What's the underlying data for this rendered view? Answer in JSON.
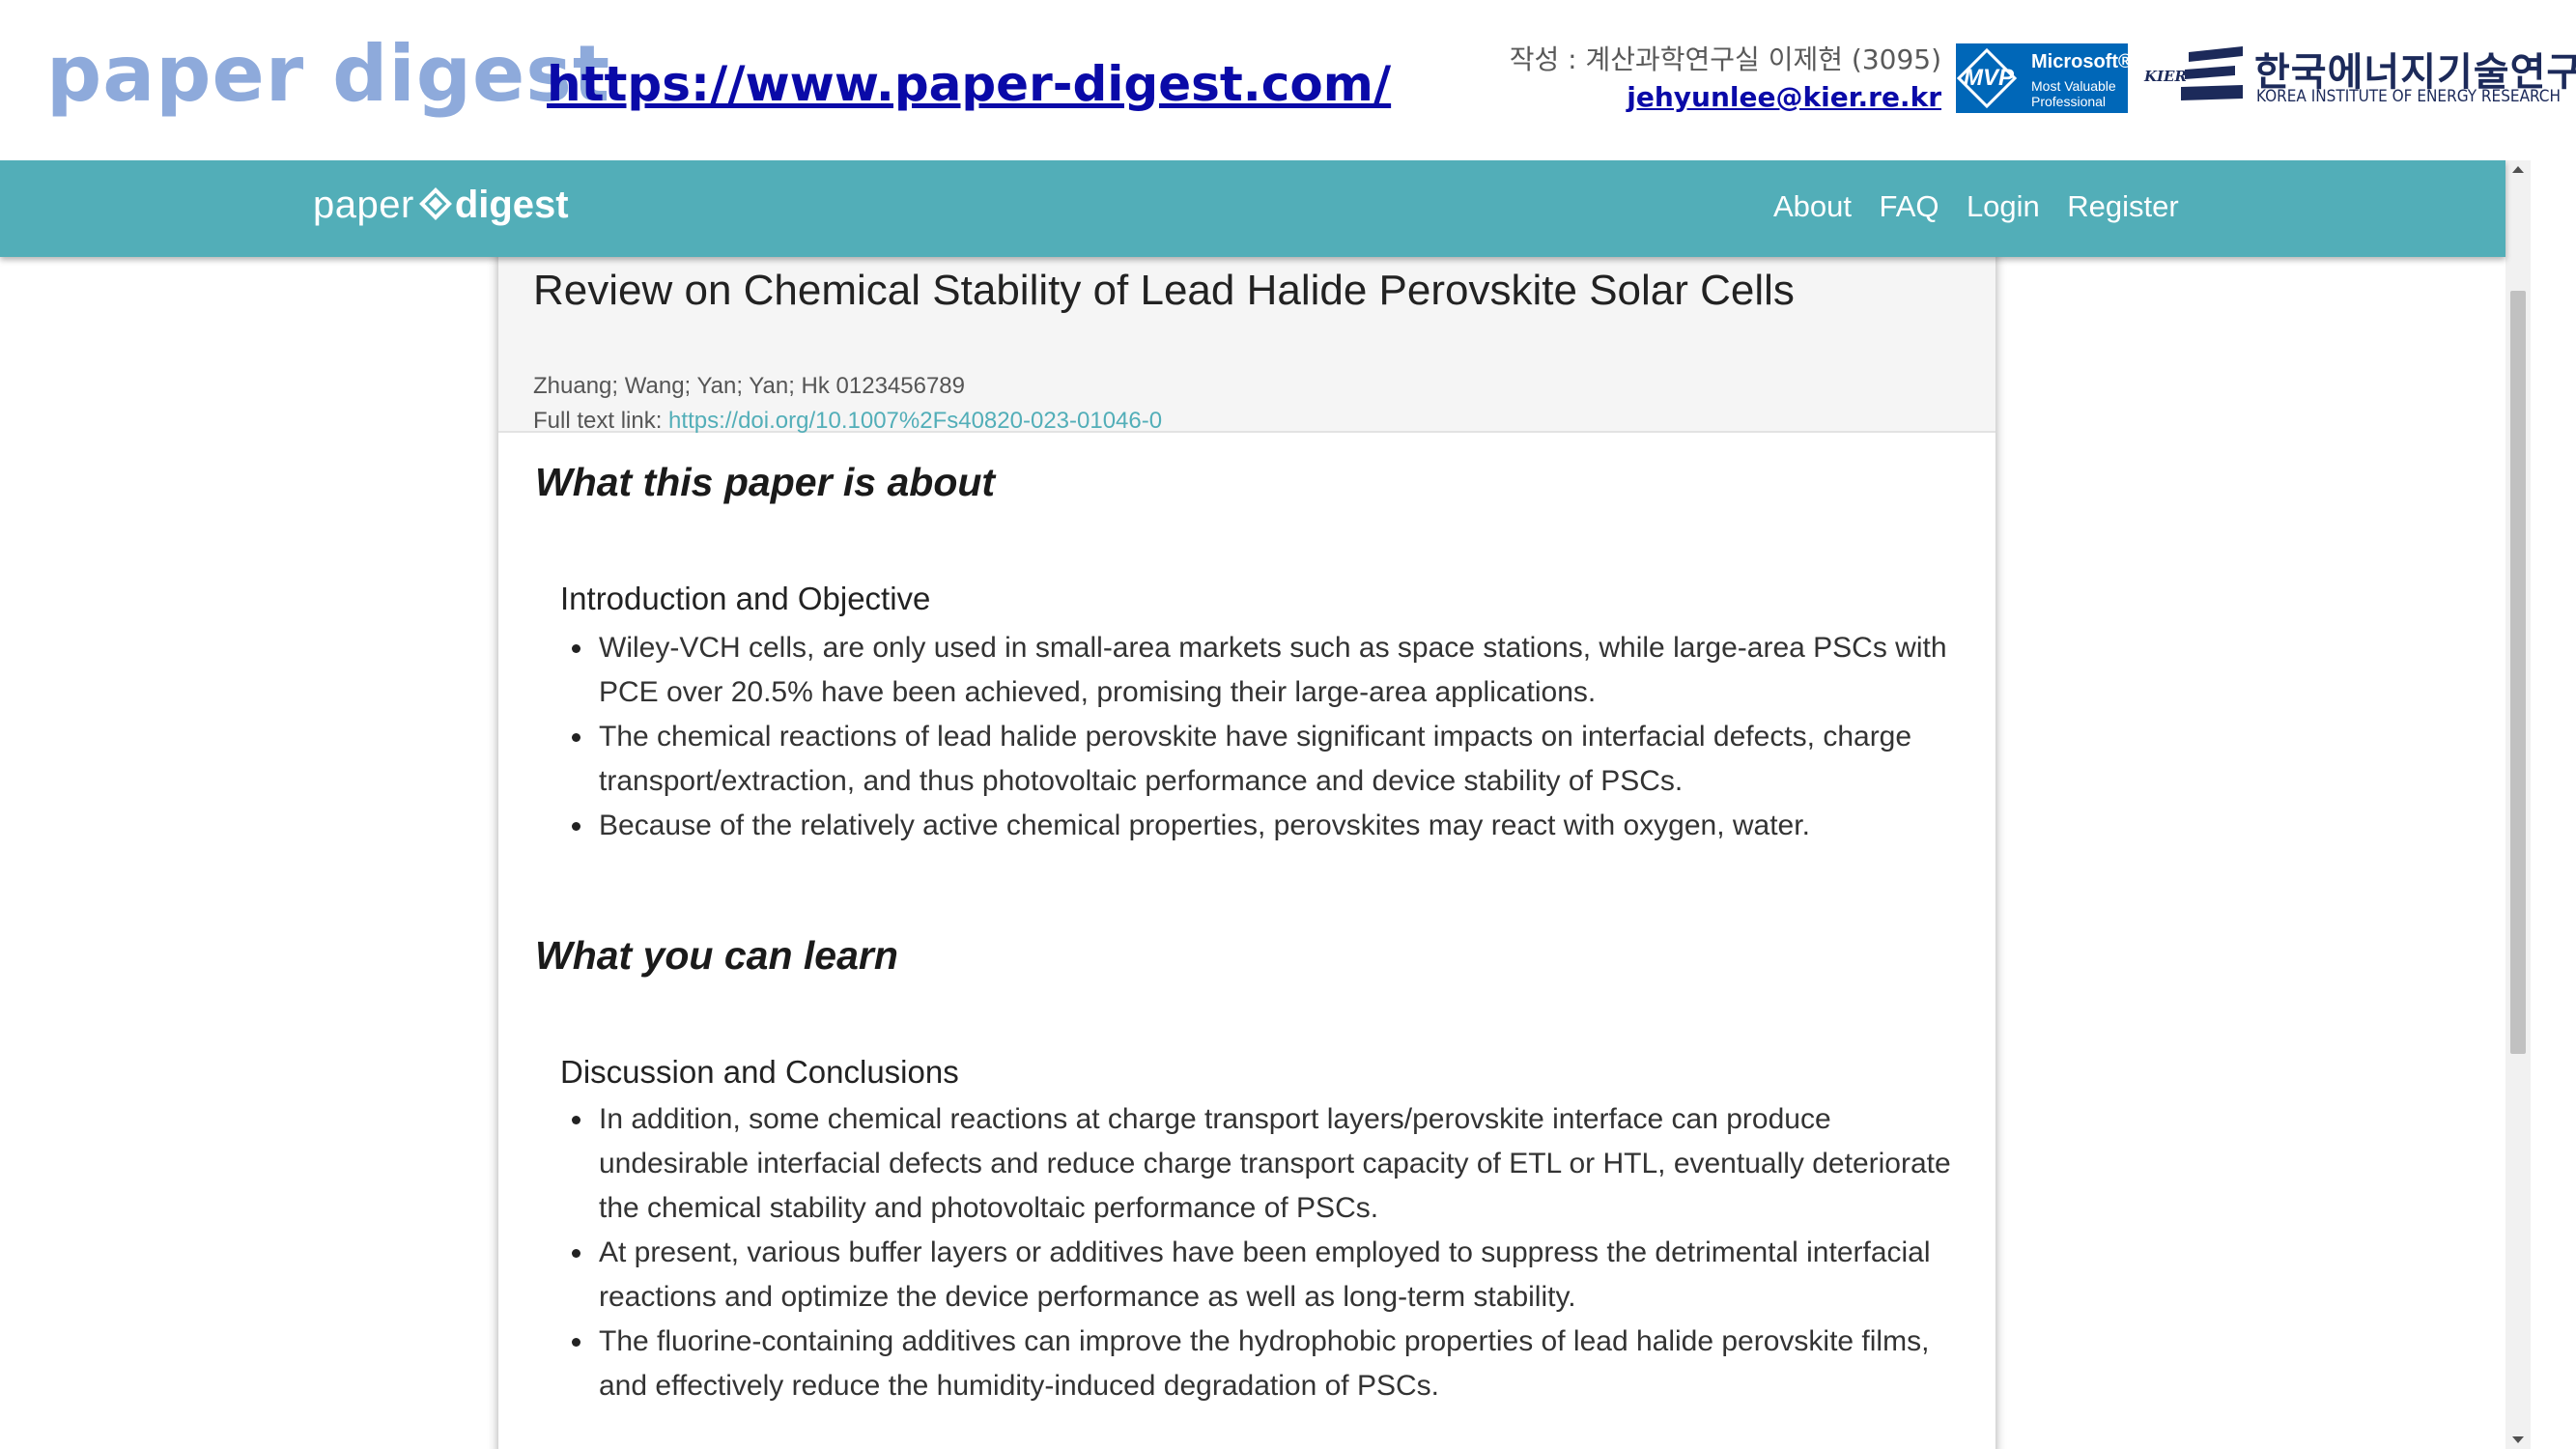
{
  "slide": {
    "title": "paper digest",
    "url": "https://www.paper-digest.com/",
    "author_line": "작성 : 계산과학연구실 이제현 (3095)",
    "author_email": "jehyunlee@kier.re.kr",
    "mvp": {
      "abbr": "MVP",
      "brand": "Microsoft®",
      "line1": "Most Valuable",
      "line2": "Professional"
    },
    "kier": {
      "mark": "KIER",
      "korean": "한국에너지기술연구원",
      "english": "KOREA INSTITUTE OF ENERGY RESEARCH"
    }
  },
  "navbar": {
    "brand_paper": "paper",
    "brand_digest": "digest",
    "links": [
      "About",
      "FAQ",
      "Login",
      "Register"
    ]
  },
  "paper": {
    "title": "Review on Chemical Stability of Lead Halide Perovskite Solar Cells",
    "authors": "Zhuang; Wang; Yan; Yan; Hk 0123456789",
    "link_label": "Full text link: ",
    "link_url": "https://doi.org/10.1007%2Fs40820-023-01046-0"
  },
  "sections": [
    {
      "heading": "What this paper is about",
      "subheading": "Introduction and Objective",
      "bullets": [
        "Wiley-VCH cells, are only used in small-area markets such as space stations, while large-area PSCs with PCE over 20.5% have been achieved, promising their large-area applications.",
        "The chemical reactions of lead halide perovskite have significant impacts on interfacial defects, charge transport/extraction, and thus photovoltaic performance and device stability of PSCs.",
        "Because of the relatively active chemical properties, perovskites may react with oxygen, water."
      ]
    },
    {
      "heading": "What you can learn",
      "subheading": "Discussion and Conclusions",
      "bullets": [
        "In addition, some chemical reactions at charge transport layers/perovskite interface can produce undesirable interfacial defects and reduce charge transport capacity of ETL or HTL, eventually deteriorate the chemical stability and photovoltaic performance of PSCs.",
        "At present, various buffer layers or additives have been employed to suppress the detrimental interfacial reactions and optimize the device performance as well as long-term stability.",
        "The fluorine-containing additives can improve the hydrophobic properties of lead halide perovskite films, and effectively reduce the humidity-induced degradation of PSCs."
      ]
    }
  ],
  "colors": {
    "navbar": "#52aeb8",
    "slide_title": "#8eaadb",
    "link": "#0a0aa8",
    "mvp": "#0067b8",
    "kier": "#1c2a5a"
  }
}
